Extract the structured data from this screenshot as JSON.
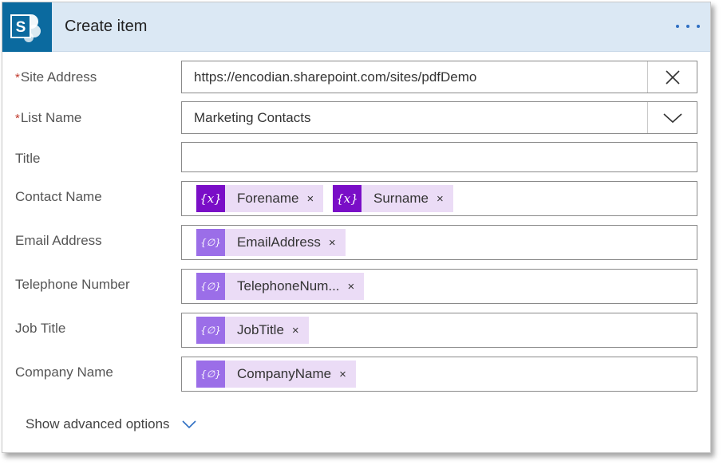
{
  "header": {
    "title": "Create item",
    "logo_letter": "S",
    "icon": "sharepoint-icon",
    "more_icon": "more-options-icon"
  },
  "fields": {
    "site_address": {
      "label": "Site Address",
      "required_mark": "*",
      "value": "https://encodian.sharepoint.com/sites/pdfDemo",
      "action_icon": "close-icon"
    },
    "list_name": {
      "label": "List Name",
      "required_mark": "*",
      "value": "Marketing Contacts",
      "action_icon": "chevron-down-icon"
    },
    "title": {
      "label": "Title",
      "value": ""
    },
    "contact_name": {
      "label": "Contact Name",
      "tokens": [
        {
          "icon_text": "{x}",
          "label": "Forename",
          "remove": "×"
        },
        {
          "icon_text": "{x}",
          "label": "Surname",
          "remove": "×"
        }
      ]
    },
    "email_address": {
      "label": "Email Address",
      "tokens": [
        {
          "icon_text": "{∅}",
          "label": "EmailAddress",
          "remove": "×"
        }
      ]
    },
    "telephone_number": {
      "label": "Telephone Number",
      "tokens": [
        {
          "icon_text": "{∅}",
          "label": "TelephoneNum...",
          "remove": "×"
        }
      ]
    },
    "job_title": {
      "label": "Job Title",
      "tokens": [
        {
          "icon_text": "{∅}",
          "label": "JobTitle",
          "remove": "×"
        }
      ]
    },
    "company_name": {
      "label": "Company Name",
      "tokens": [
        {
          "icon_text": "{∅}",
          "label": "CompanyName",
          "remove": "×"
        }
      ]
    }
  },
  "advanced": {
    "label": "Show advanced options",
    "icon": "chevron-down-icon"
  },
  "colors": {
    "header_bg": "#dbe8f4",
    "logo_bg": "#0b6a9f",
    "variable_token": "#7a0ec7",
    "dynamic_token": "#9b6ee8",
    "token_bg": "#ebdcf6",
    "accent": "#2f6fc3",
    "required": "#c0392b"
  }
}
